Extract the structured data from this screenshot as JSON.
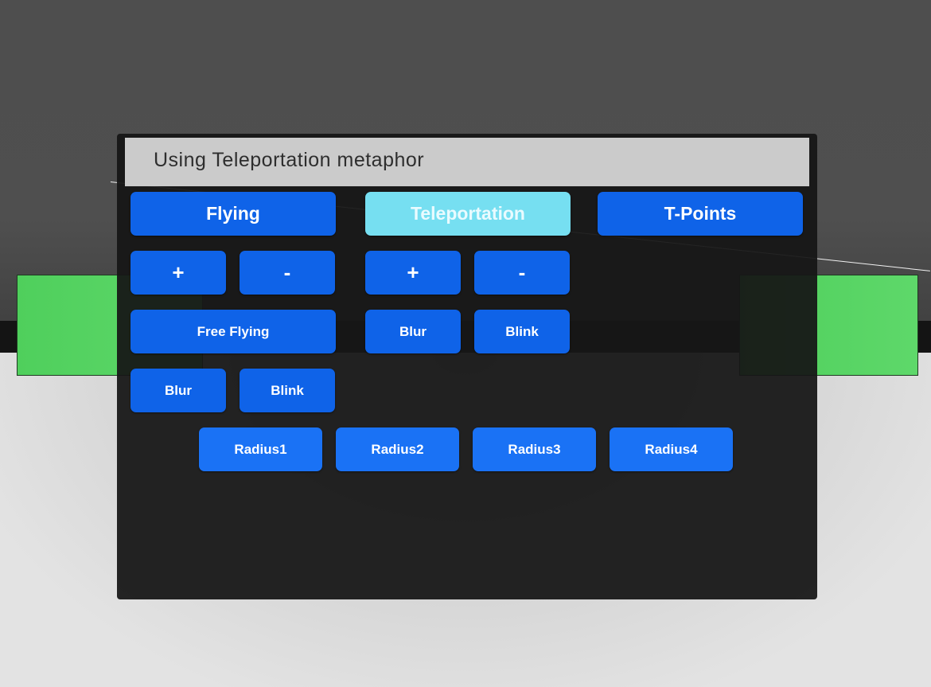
{
  "status_text": "Using Teleportation metaphor",
  "modes": [
    {
      "label": "Flying",
      "active": false
    },
    {
      "label": "Teleportation",
      "active": true
    },
    {
      "label": "T-Points",
      "active": false
    }
  ],
  "flying_controls": {
    "plus": "+",
    "minus": "-",
    "free_flying": "Free Flying",
    "blur": "Blur",
    "blink": "Blink"
  },
  "teleport_controls": {
    "plus": "+",
    "minus": "-",
    "blur": "Blur",
    "blink": "Blink"
  },
  "radius_buttons": [
    "Radius1",
    "Radius2",
    "Radius3",
    "Radius4"
  ],
  "colors": {
    "button": "#0f63e8",
    "active_button": "#76dff1",
    "panel": "#161616",
    "status_bar": "#cbcbcb",
    "block": "#4fcf5c"
  }
}
